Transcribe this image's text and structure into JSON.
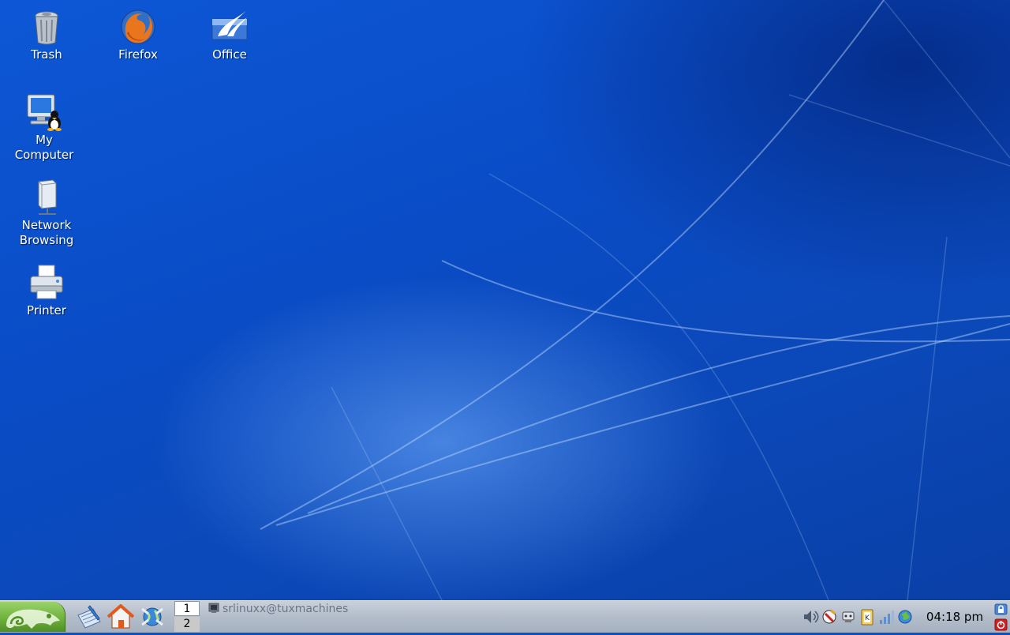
{
  "desktop": {
    "icons": [
      {
        "label_line1": "Trash",
        "label_line2": ""
      },
      {
        "label_line1": "Firefox",
        "label_line2": ""
      },
      {
        "label_line1": "Office",
        "label_line2": ""
      },
      {
        "label_line1": "My",
        "label_line2": "Computer"
      },
      {
        "label_line1": "Network",
        "label_line2": "Browsing"
      },
      {
        "label_line1": "Printer",
        "label_line2": ""
      }
    ]
  },
  "taskbar": {
    "start_icon": "suse-chameleon-icon",
    "quick_launch": [
      {
        "icon": "text-editor-icon"
      },
      {
        "icon": "home-folder-icon"
      },
      {
        "icon": "web-browser-icon"
      }
    ],
    "pager": {
      "desktops": [
        "1",
        "2"
      ],
      "active": "1"
    },
    "task_item": {
      "icon": "terminal-icon",
      "label": "srlinuxx@tuxmachines"
    },
    "tray": [
      {
        "icon": "volume-icon"
      },
      {
        "icon": "updater-icon"
      },
      {
        "icon": "network-manager-icon"
      },
      {
        "icon": "clipboard-icon"
      },
      {
        "icon": "signal-strength-icon"
      },
      {
        "icon": "globe-icon"
      }
    ],
    "clock": "04:18 pm",
    "lock_icon": "lock-screen-icon",
    "logout_icon": "logout-icon"
  },
  "colors": {
    "wallpaper": "#0a4fc8",
    "taskbar": "#b3bdca",
    "start_button": "#6fb23c",
    "logout": "#d42020"
  }
}
